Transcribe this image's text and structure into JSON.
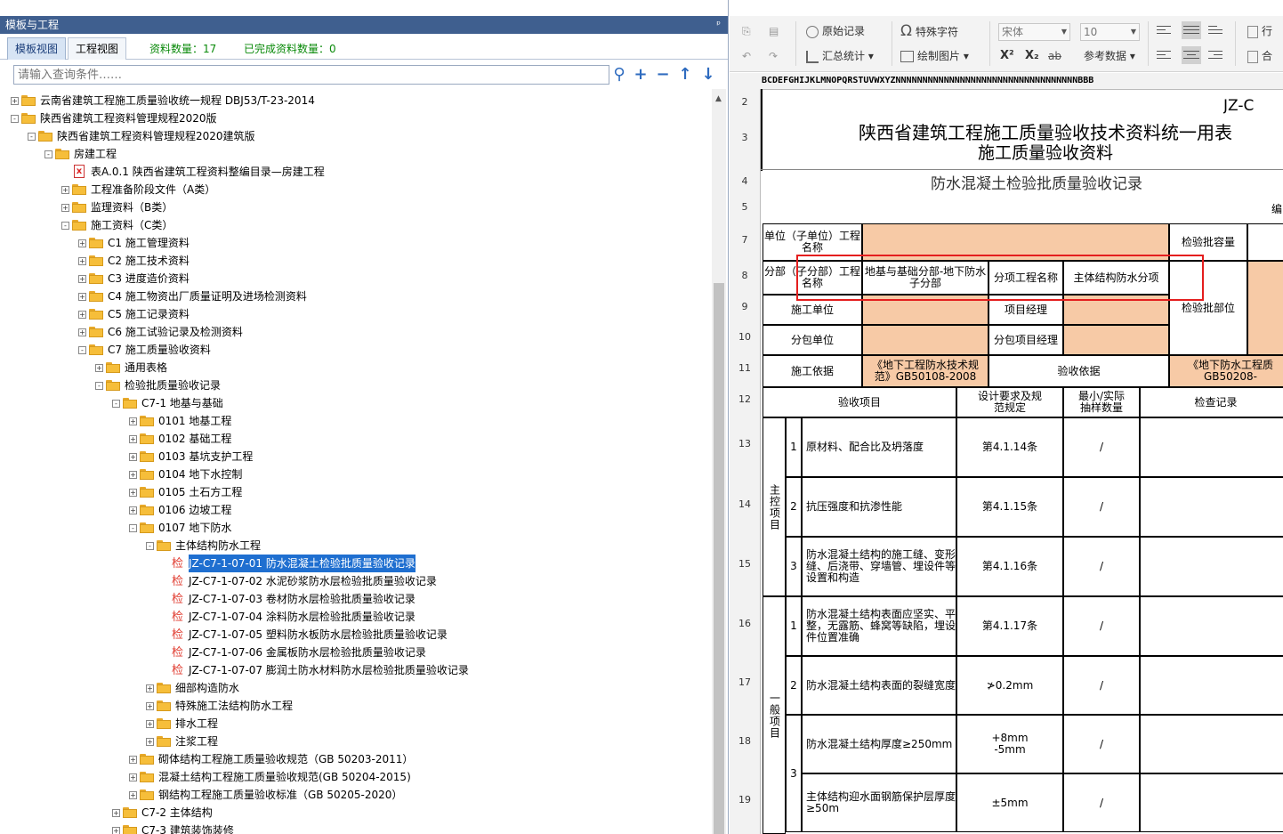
{
  "left_panel": {
    "title": "模板与工程",
    "pin": "𝌆",
    "tabs": [
      "模板视图",
      "工程视图"
    ],
    "count_label": "资料数量：17",
    "done_label": "已完成资料数量：0",
    "search_placeholder": "请输入查询条件……",
    "search_buttons": [
      "search-icon",
      "add-icon",
      "minus-icon",
      "arrow-up-icon",
      "arrow-down-icon"
    ]
  },
  "tree": [
    {
      "level": 0,
      "exp": "+",
      "icon": "folder",
      "text": "云南省建筑工程施工质量验收统一规程 DBJ53/T-23-2014"
    },
    {
      "level": 0,
      "exp": "-",
      "icon": "folder",
      "text": "陕西省建筑工程资料管理规程2020版"
    },
    {
      "level": 1,
      "exp": "-",
      "icon": "folder",
      "text": "陕西省建筑工程资料管理规程2020建筑版"
    },
    {
      "level": 2,
      "exp": "-",
      "icon": "folder",
      "text": "房建工程"
    },
    {
      "level": 3,
      "exp": "",
      "icon": "doc",
      "text": "表A.0.1 陕西省建筑工程资料整编目录—房建工程"
    },
    {
      "level": 3,
      "exp": "+",
      "icon": "folder",
      "text": "工程准备阶段文件（A类）"
    },
    {
      "level": 3,
      "exp": "+",
      "icon": "folder",
      "text": "监理资料（B类）"
    },
    {
      "level": 3,
      "exp": "-",
      "icon": "folder",
      "text": "施工资料（C类）"
    },
    {
      "level": 4,
      "exp": "+",
      "icon": "folder",
      "text": "C1 施工管理资料"
    },
    {
      "level": 4,
      "exp": "+",
      "icon": "folder",
      "text": "C2 施工技术资料"
    },
    {
      "level": 4,
      "exp": "+",
      "icon": "folder",
      "text": "C3 进度造价资料"
    },
    {
      "level": 4,
      "exp": "+",
      "icon": "folder",
      "text": "C4 施工物资出厂质量证明及进场检测资料"
    },
    {
      "level": 4,
      "exp": "+",
      "icon": "folder",
      "text": "C5 施工记录资料"
    },
    {
      "level": 4,
      "exp": "+",
      "icon": "folder",
      "text": "C6 施工试验记录及检测资料"
    },
    {
      "level": 4,
      "exp": "-",
      "icon": "folder",
      "text": "C7 施工质量验收资料"
    },
    {
      "level": 5,
      "exp": "+",
      "icon": "folder",
      "text": "通用表格"
    },
    {
      "level": 5,
      "exp": "-",
      "icon": "folder",
      "text": "检验批质量验收记录"
    },
    {
      "level": 6,
      "exp": "-",
      "icon": "folder",
      "text": "C7-1 地基与基础"
    },
    {
      "level": 7,
      "exp": "+",
      "icon": "folder",
      "text": "0101 地基工程"
    },
    {
      "level": 7,
      "exp": "+",
      "icon": "folder",
      "text": "0102 基础工程"
    },
    {
      "level": 7,
      "exp": "+",
      "icon": "folder",
      "text": "0103 基坑支护工程"
    },
    {
      "level": 7,
      "exp": "+",
      "icon": "folder",
      "text": "0104 地下水控制"
    },
    {
      "level": 7,
      "exp": "+",
      "icon": "folder",
      "text": "0105 土石方工程"
    },
    {
      "level": 7,
      "exp": "+",
      "icon": "folder",
      "text": "0106 边坡工程"
    },
    {
      "level": 7,
      "exp": "-",
      "icon": "folder",
      "text": "0107 地下防水"
    },
    {
      "level": 8,
      "exp": "-",
      "icon": "folder",
      "text": "主体结构防水工程"
    },
    {
      "level": 9,
      "exp": "",
      "icon": "check",
      "text": "JZ-C7-1-07-01 防水混凝土检验批质量验收记录",
      "selected": true
    },
    {
      "level": 9,
      "exp": "",
      "icon": "check",
      "text": "JZ-C7-1-07-02 水泥砂浆防水层检验批质量验收记录"
    },
    {
      "level": 9,
      "exp": "",
      "icon": "check",
      "text": "JZ-C7-1-07-03 卷材防水层检验批质量验收记录"
    },
    {
      "level": 9,
      "exp": "",
      "icon": "check",
      "text": "JZ-C7-1-07-04 涂料防水层检验批质量验收记录"
    },
    {
      "level": 9,
      "exp": "",
      "icon": "check",
      "text": "JZ-C7-1-07-05 塑料防水板防水层检验批质量验收记录"
    },
    {
      "level": 9,
      "exp": "",
      "icon": "check",
      "text": "JZ-C7-1-07-06 金属板防水层检验批质量验收记录"
    },
    {
      "level": 9,
      "exp": "",
      "icon": "check",
      "text": "JZ-C7-1-07-07 膨润土防水材料防水层检验批质量验收记录"
    },
    {
      "level": 8,
      "exp": "+",
      "icon": "folder",
      "text": "细部构造防水"
    },
    {
      "level": 8,
      "exp": "+",
      "icon": "folder",
      "text": "特殊施工法结构防水工程"
    },
    {
      "level": 8,
      "exp": "+",
      "icon": "folder",
      "text": "排水工程"
    },
    {
      "level": 8,
      "exp": "+",
      "icon": "folder",
      "text": "注浆工程"
    },
    {
      "level": 7,
      "exp": "+",
      "icon": "folder",
      "text": "砌体结构工程施工质量验收规范（GB 50203-2011）"
    },
    {
      "level": 7,
      "exp": "+",
      "icon": "folder",
      "text": "混凝土结构工程施工质量验收规范(GB 50204-2015)"
    },
    {
      "level": 7,
      "exp": "+",
      "icon": "folder",
      "text": "钢结构工程施工质量验收标准（GB 50205-2020）"
    },
    {
      "level": 6,
      "exp": "+",
      "icon": "folder",
      "text": "C7-2 主体结构"
    },
    {
      "level": 6,
      "exp": "+",
      "icon": "folder",
      "text": "C7-3 建筑装饰装修"
    }
  ],
  "check_glyph": "检",
  "doc_glyph": "x",
  "ribbon": {
    "original_record": "原始记录",
    "special_char": "特殊字符",
    "summary_stats": "汇总统计",
    "draw_picture": "绘制图片",
    "font_name": "宋体",
    "font_size": "10",
    "superscript": "X²",
    "subscript": "X₂",
    "strike": "ab",
    "ref_data": "参考数据",
    "row_label": "行",
    "merge_label": "合"
  },
  "column_header": "BCDEFGHIJKLMNOPQRSTUVWXYZNNNNNNNNNNNNNNNNNNNNNNNNNNNNNNNNNNBBB",
  "row_numbers": [
    "2",
    "3",
    "4",
    "5",
    "7",
    "8",
    "9",
    "10",
    "11",
    "12",
    "13",
    "14",
    "15",
    "16",
    "17",
    "18",
    "19"
  ],
  "form": {
    "code": "JZ-C",
    "title_line1": "陕西省建筑工程施工质量验收技术资料统一用表",
    "title_line2": "施工质量验收资料",
    "subtitle": "防水混凝土检验批质量验收记录",
    "number_label": "编",
    "unit_label": "单位（子单位）工程名称",
    "capacity_label": "检验批容量",
    "division_label": "分部（子分部）工程名称",
    "division_value": "地基与基础分部-地下防水子分部",
    "subitem_label": "分项工程名称",
    "subitem_value": "主体结构防水分项",
    "contractor_label": "施工单位",
    "pm_label": "项目经理",
    "location_label": "检验批部位",
    "subcontractor_label": "分包单位",
    "sub_pm_label": "分包项目经理",
    "basis_label": "施工依据",
    "basis_value": "《地下工程防水技术规范》GB50108-2008",
    "acceptance_basis_label": "验收依据",
    "acceptance_basis_value": "《地下防水工程质GB50208-",
    "col_item": "验收项目",
    "col_design": "设计要求及规范规定",
    "col_sample": "最小/实际抽样数量",
    "col_record": "检查记录",
    "main_group": "主控项目",
    "general_group": "一般项目",
    "rows": [
      {
        "no": "1",
        "item": "原材料、配合比及坍落度",
        "spec": "第4.1.14条",
        "sample": "/"
      },
      {
        "no": "2",
        "item": "抗压强度和抗渗性能",
        "spec": "第4.1.15条",
        "sample": "/"
      },
      {
        "no": "3",
        "item": "防水混凝土结构的施工缝、变形缝、后浇带、穿墙管、埋设件等设置和构造",
        "spec": "第4.1.16条",
        "sample": "/"
      },
      {
        "no": "1",
        "item": "防水混凝土结构表面应坚实、平整，无露筋、蜂窝等缺陷，埋设件位置准确",
        "spec": "第4.1.17条",
        "sample": "/"
      },
      {
        "no": "2",
        "item": "防水混凝土结构表面的裂缝宽度",
        "spec": "≯0.2mm",
        "sample": "/"
      },
      {
        "no": "3",
        "item": "防水混凝土结构厚度≥250mm",
        "spec": "+8mm\n-5mm",
        "sample": "/"
      },
      {
        "no": "",
        "item": "主体结构迎水面钢筋保护层厚度≥50m",
        "spec": "±5mm",
        "sample": "/"
      }
    ]
  },
  "colors": {
    "title_bar": "#3f5f8f",
    "highlight_fill": "#f7caa6",
    "selection": "#1f6fd0",
    "red_box": "#e41e1e",
    "count_green": "#0a8a0a"
  }
}
